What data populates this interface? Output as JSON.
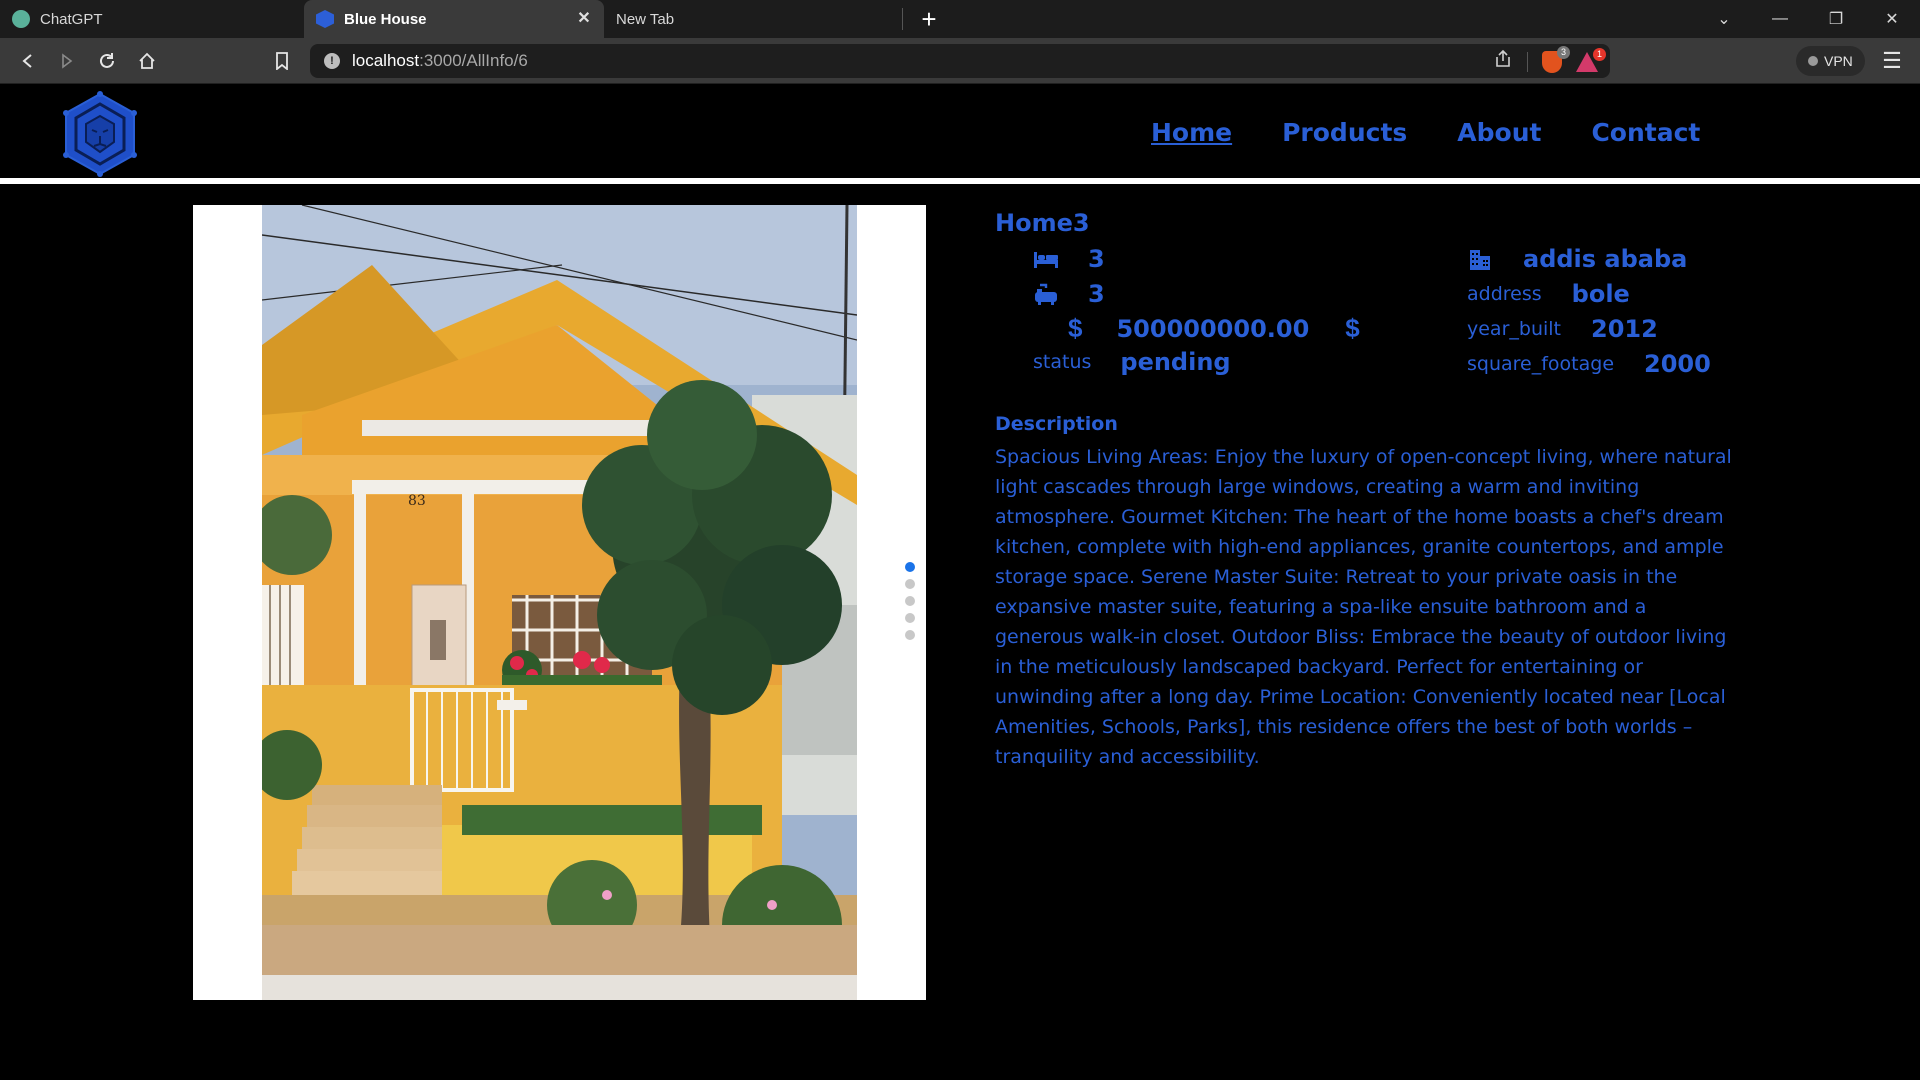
{
  "browser": {
    "tabs": [
      {
        "title": "ChatGPT",
        "favicon": "chatgpt-icon"
      },
      {
        "title": "Blue House",
        "favicon": "blue-house-hex-icon",
        "active": true
      },
      {
        "title": "New Tab",
        "favicon": ""
      }
    ],
    "url": {
      "host": "localhost",
      "path": ":3000/AllInfo/6"
    },
    "shield_badge": "3",
    "rewards_badge": "1",
    "vpn_label": "VPN"
  },
  "site": {
    "logo_icon": "lion-hexagon-logo",
    "nav": [
      "Home",
      "Products",
      "About",
      "Contact"
    ],
    "active_nav": "Home",
    "accent": "#2a5fd6"
  },
  "carousel": {
    "slide_count": 5,
    "active_slide": 1,
    "photo": "orange-house-with-tree"
  },
  "property": {
    "name": "Home3",
    "bedrooms": "3",
    "bathrooms": "3",
    "price": "500000000.00",
    "currency_symbol": "$",
    "status_label": "status",
    "status": "pending",
    "city": "addis ababa",
    "address_label": "address",
    "address": "bole",
    "year_built_label": "year_built",
    "year_built": "2012",
    "square_footage_label": "square_footage",
    "square_footage": "2000",
    "description_heading": "Description",
    "description": "Spacious Living Areas: Enjoy the luxury of open-concept living, where natural light cascades through large windows, creating a warm and inviting atmosphere. Gourmet Kitchen: The heart of the home boasts a chef's dream kitchen, complete with high-end appliances, granite countertops, and ample storage space. Serene Master Suite: Retreat to your private oasis in the expansive master suite, featuring a spa-like ensuite bathroom and a generous walk-in closet. Outdoor Bliss: Embrace the beauty of outdoor living in the meticulously landscaped backyard. Perfect for entertaining or unwinding after a long day. Prime Location: Conveniently located near [Local Amenities, Schools, Parks], this residence offers the best of both worlds – tranquility and accessibility."
  }
}
